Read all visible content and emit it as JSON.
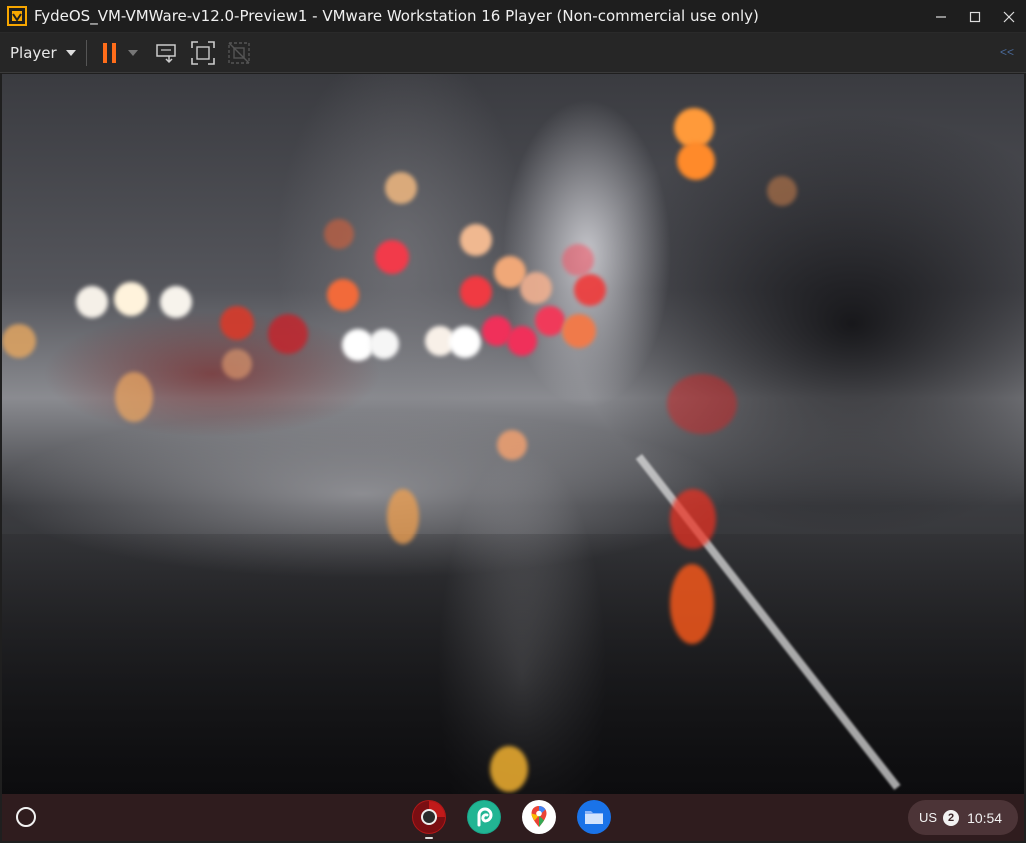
{
  "window": {
    "title": "FydeOS_VM-VMWare-v12.0-Preview1 - VMware Workstation 16 Player (Non-commercial use only)"
  },
  "toolbar": {
    "player_label": "Player",
    "icons": [
      "pause-icon",
      "dropdown-arrow-icon",
      "send-ctrl-alt-del-icon",
      "fullscreen-icon",
      "unity-icon",
      "collapse-toolbar-icon"
    ],
    "collapse_label": "<<"
  },
  "colors": {
    "pause_accent": "#ff6d1a",
    "titlebar_bg": "#1e1e1e",
    "toolbar_bg": "#262626",
    "shelf_bg": "#301c1e"
  },
  "shelf": {
    "apps": [
      {
        "name": "chromium-icon"
      },
      {
        "name": "picsart-icon"
      },
      {
        "name": "google-maps-icon"
      },
      {
        "name": "files-icon"
      }
    ],
    "tray": {
      "ime": "US",
      "notifications": "2",
      "time": "10:54"
    }
  }
}
